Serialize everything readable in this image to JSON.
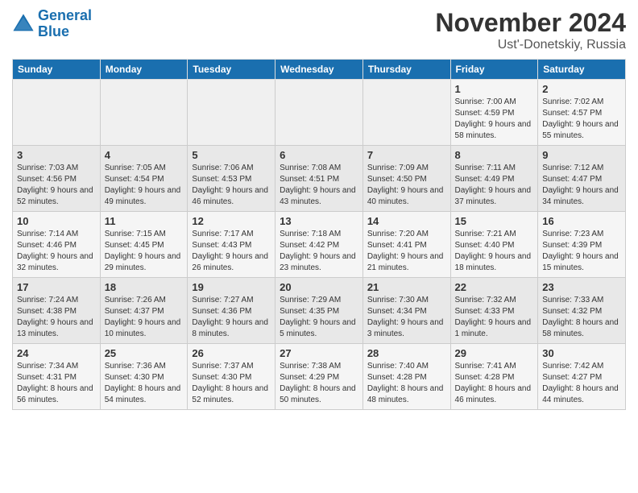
{
  "logo": {
    "line1": "General",
    "line2": "Blue"
  },
  "title": "November 2024",
  "subtitle": "Ust'-Donetskiy, Russia",
  "weekdays": [
    "Sunday",
    "Monday",
    "Tuesday",
    "Wednesday",
    "Thursday",
    "Friday",
    "Saturday"
  ],
  "weeks": [
    [
      {
        "day": "",
        "info": ""
      },
      {
        "day": "",
        "info": ""
      },
      {
        "day": "",
        "info": ""
      },
      {
        "day": "",
        "info": ""
      },
      {
        "day": "",
        "info": ""
      },
      {
        "day": "1",
        "info": "Sunrise: 7:00 AM\nSunset: 4:59 PM\nDaylight: 9 hours and 58 minutes."
      },
      {
        "day": "2",
        "info": "Sunrise: 7:02 AM\nSunset: 4:57 PM\nDaylight: 9 hours and 55 minutes."
      }
    ],
    [
      {
        "day": "3",
        "info": "Sunrise: 7:03 AM\nSunset: 4:56 PM\nDaylight: 9 hours and 52 minutes."
      },
      {
        "day": "4",
        "info": "Sunrise: 7:05 AM\nSunset: 4:54 PM\nDaylight: 9 hours and 49 minutes."
      },
      {
        "day": "5",
        "info": "Sunrise: 7:06 AM\nSunset: 4:53 PM\nDaylight: 9 hours and 46 minutes."
      },
      {
        "day": "6",
        "info": "Sunrise: 7:08 AM\nSunset: 4:51 PM\nDaylight: 9 hours and 43 minutes."
      },
      {
        "day": "7",
        "info": "Sunrise: 7:09 AM\nSunset: 4:50 PM\nDaylight: 9 hours and 40 minutes."
      },
      {
        "day": "8",
        "info": "Sunrise: 7:11 AM\nSunset: 4:49 PM\nDaylight: 9 hours and 37 minutes."
      },
      {
        "day": "9",
        "info": "Sunrise: 7:12 AM\nSunset: 4:47 PM\nDaylight: 9 hours and 34 minutes."
      }
    ],
    [
      {
        "day": "10",
        "info": "Sunrise: 7:14 AM\nSunset: 4:46 PM\nDaylight: 9 hours and 32 minutes."
      },
      {
        "day": "11",
        "info": "Sunrise: 7:15 AM\nSunset: 4:45 PM\nDaylight: 9 hours and 29 minutes."
      },
      {
        "day": "12",
        "info": "Sunrise: 7:17 AM\nSunset: 4:43 PM\nDaylight: 9 hours and 26 minutes."
      },
      {
        "day": "13",
        "info": "Sunrise: 7:18 AM\nSunset: 4:42 PM\nDaylight: 9 hours and 23 minutes."
      },
      {
        "day": "14",
        "info": "Sunrise: 7:20 AM\nSunset: 4:41 PM\nDaylight: 9 hours and 21 minutes."
      },
      {
        "day": "15",
        "info": "Sunrise: 7:21 AM\nSunset: 4:40 PM\nDaylight: 9 hours and 18 minutes."
      },
      {
        "day": "16",
        "info": "Sunrise: 7:23 AM\nSunset: 4:39 PM\nDaylight: 9 hours and 15 minutes."
      }
    ],
    [
      {
        "day": "17",
        "info": "Sunrise: 7:24 AM\nSunset: 4:38 PM\nDaylight: 9 hours and 13 minutes."
      },
      {
        "day": "18",
        "info": "Sunrise: 7:26 AM\nSunset: 4:37 PM\nDaylight: 9 hours and 10 minutes."
      },
      {
        "day": "19",
        "info": "Sunrise: 7:27 AM\nSunset: 4:36 PM\nDaylight: 9 hours and 8 minutes."
      },
      {
        "day": "20",
        "info": "Sunrise: 7:29 AM\nSunset: 4:35 PM\nDaylight: 9 hours and 5 minutes."
      },
      {
        "day": "21",
        "info": "Sunrise: 7:30 AM\nSunset: 4:34 PM\nDaylight: 9 hours and 3 minutes."
      },
      {
        "day": "22",
        "info": "Sunrise: 7:32 AM\nSunset: 4:33 PM\nDaylight: 9 hours and 1 minute."
      },
      {
        "day": "23",
        "info": "Sunrise: 7:33 AM\nSunset: 4:32 PM\nDaylight: 8 hours and 58 minutes."
      }
    ],
    [
      {
        "day": "24",
        "info": "Sunrise: 7:34 AM\nSunset: 4:31 PM\nDaylight: 8 hours and 56 minutes."
      },
      {
        "day": "25",
        "info": "Sunrise: 7:36 AM\nSunset: 4:30 PM\nDaylight: 8 hours and 54 minutes."
      },
      {
        "day": "26",
        "info": "Sunrise: 7:37 AM\nSunset: 4:30 PM\nDaylight: 8 hours and 52 minutes."
      },
      {
        "day": "27",
        "info": "Sunrise: 7:38 AM\nSunset: 4:29 PM\nDaylight: 8 hours and 50 minutes."
      },
      {
        "day": "28",
        "info": "Sunrise: 7:40 AM\nSunset: 4:28 PM\nDaylight: 8 hours and 48 minutes."
      },
      {
        "day": "29",
        "info": "Sunrise: 7:41 AM\nSunset: 4:28 PM\nDaylight: 8 hours and 46 minutes."
      },
      {
        "day": "30",
        "info": "Sunrise: 7:42 AM\nSunset: 4:27 PM\nDaylight: 8 hours and 44 minutes."
      }
    ]
  ]
}
